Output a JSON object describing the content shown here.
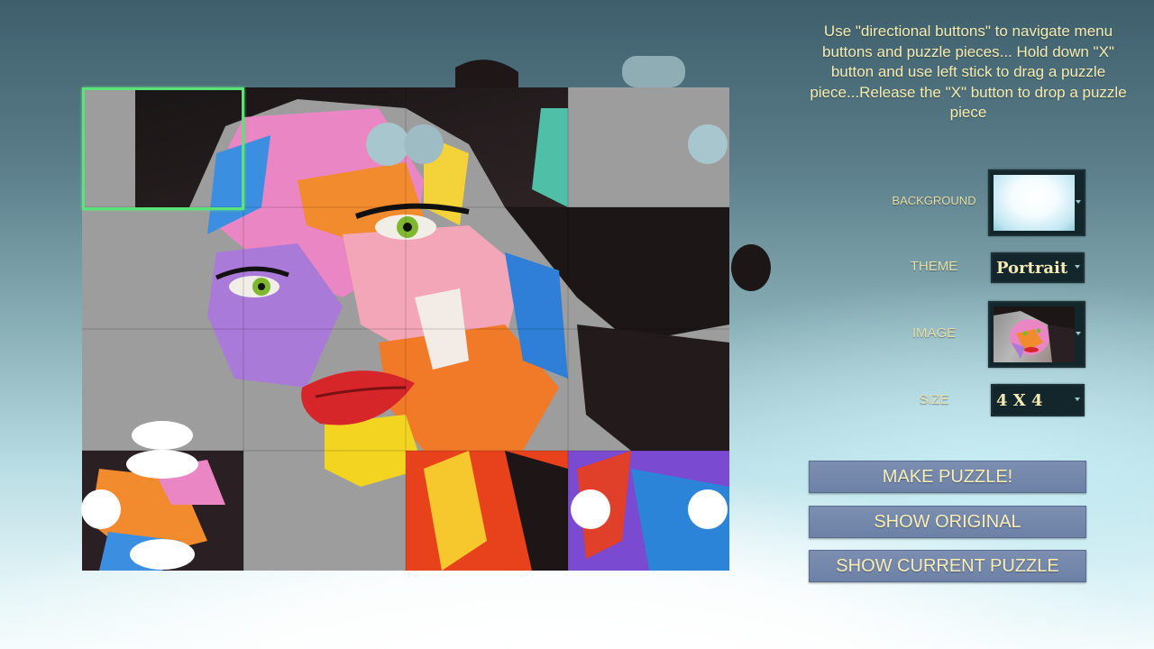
{
  "instructions": "Use \"directional buttons\" to navigate menu buttons and puzzle pieces... Hold down \"X\" button and use left stick to drag a puzzle piece...Release the \"X\" button to drop a puzzle piece",
  "options": {
    "background": {
      "label": "BACKGROUND"
    },
    "theme": {
      "label": "THEME",
      "value": "Portrait"
    },
    "image": {
      "label": "IMAGE"
    },
    "size": {
      "label": "SIZE",
      "value": "4 X 4"
    }
  },
  "buttons": {
    "make_puzzle": "MAKE PUZZLE!",
    "show_original": "SHOW ORIGINAL",
    "show_current": "SHOW CURRENT PUZZLE"
  },
  "puzzle": {
    "grid": "4x4",
    "selected_piece": "row 1, column 1"
  },
  "colors": {
    "text_yellow": "#f6edb0",
    "button_blue": "#7c8fb2",
    "selection_green": "#5be37a"
  }
}
